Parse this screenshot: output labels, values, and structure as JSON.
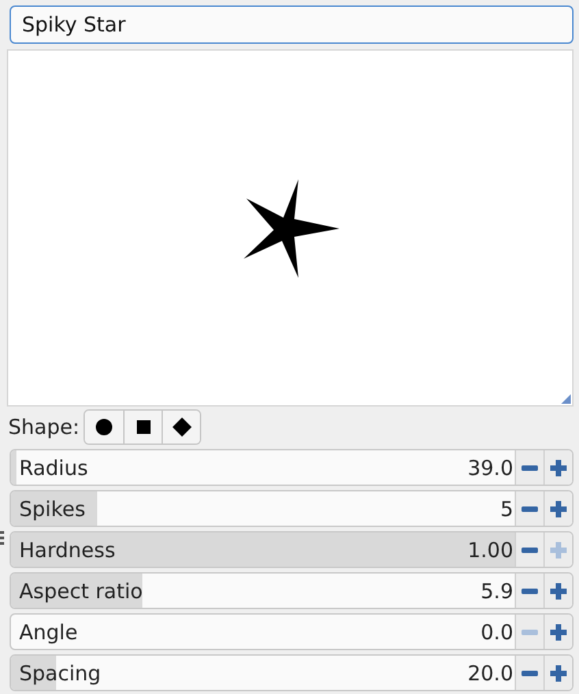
{
  "name_field": {
    "value": "Spiky Star"
  },
  "shape": {
    "label": "Shape:",
    "options": [
      {
        "kind": "circle",
        "selected": false
      },
      {
        "kind": "square",
        "selected": false
      },
      {
        "kind": "diamond",
        "selected": false
      }
    ]
  },
  "parameters": [
    {
      "label": "Radius",
      "value": "39.0",
      "level": 0.01,
      "minus_disabled": false,
      "plus_disabled": false
    },
    {
      "label": "Spikes",
      "value": "5",
      "level": 0.17,
      "minus_disabled": false,
      "plus_disabled": false
    },
    {
      "label": "Hardness",
      "value": "1.00",
      "level": 1,
      "minus_disabled": false,
      "plus_disabled": true
    },
    {
      "label": "Aspect ratio",
      "value": "5.9",
      "level": 0.26,
      "minus_disabled": false,
      "plus_disabled": false
    },
    {
      "label": "Angle",
      "value": "0.0",
      "level": 0,
      "minus_disabled": true,
      "plus_disabled": false
    },
    {
      "label": "Spacing",
      "value": "20.0",
      "level": 0.09,
      "minus_disabled": false,
      "plus_disabled": false
    }
  ]
}
